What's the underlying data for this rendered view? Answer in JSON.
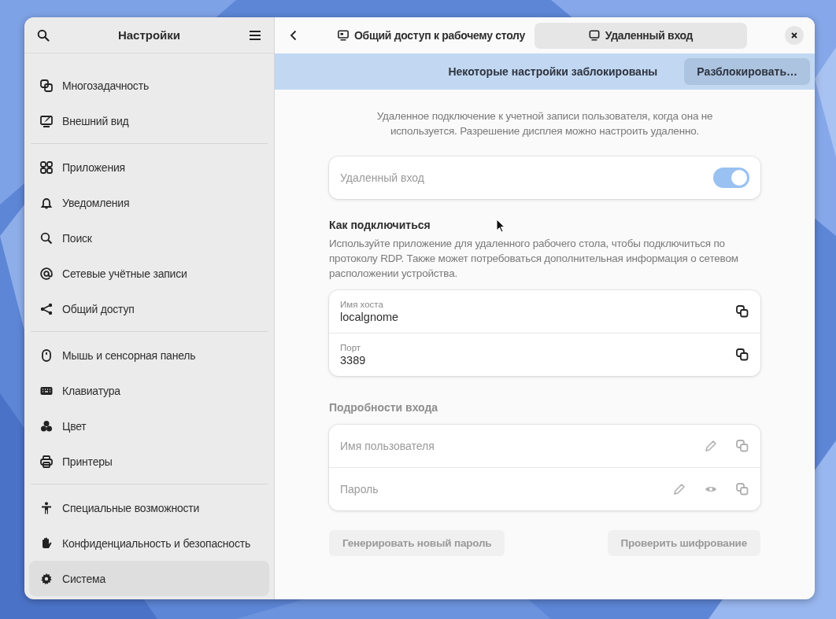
{
  "sidebar": {
    "title": "Настройки",
    "groups": [
      {
        "items": [
          {
            "label": "Многозадачность",
            "selected": false
          },
          {
            "label": "Внешний вид",
            "selected": false
          }
        ]
      },
      {
        "items": [
          {
            "label": "Приложения",
            "selected": false
          },
          {
            "label": "Уведомления",
            "selected": false
          },
          {
            "label": "Поиск",
            "selected": false
          },
          {
            "label": "Сетевые учётные записи",
            "selected": false
          },
          {
            "label": "Общий доступ",
            "selected": false
          }
        ]
      },
      {
        "items": [
          {
            "label": "Мышь и сенсорная панель",
            "selected": false
          },
          {
            "label": "Клавиатура",
            "selected": false
          },
          {
            "label": "Цвет",
            "selected": false
          },
          {
            "label": "Принтеры",
            "selected": false
          }
        ]
      },
      {
        "items": [
          {
            "label": "Специальные возможности",
            "selected": false
          },
          {
            "label": "Конфиденциальность и безопасность",
            "selected": false
          },
          {
            "label": "Система",
            "selected": true
          }
        ]
      }
    ]
  },
  "tabs": [
    {
      "label": "Общий доступ к рабочему столу",
      "selected": false
    },
    {
      "label": "Удаленный вход",
      "selected": true
    }
  ],
  "banner": {
    "message": "Некоторые настройки заблокированы",
    "button": "Разблокировать…"
  },
  "description": "Удаленное подключение к учетной записи пользователя, когда она не используется. Разрешение дисплея можно настроить удаленно.",
  "switch_row": {
    "label": "Удаленный вход",
    "on": true,
    "disabled": true
  },
  "how_to_connect": {
    "heading": "Как подключиться",
    "text": "Используйте приложение для удаленного рабочего стола, чтобы подключиться по протоколу RDP. Также может потребоваться дополнительная информация о сетевом расположении устройства.",
    "rows": [
      {
        "title": "Имя хоста",
        "value": "localgnome"
      },
      {
        "title": "Порт",
        "value": "3389"
      }
    ]
  },
  "login_details": {
    "heading": "Подробности входа",
    "disabled": true,
    "rows": [
      {
        "label": "Имя пользователя",
        "kind": "username"
      },
      {
        "label": "Пароль",
        "kind": "password"
      }
    ]
  },
  "buttons": [
    {
      "label": "Генерировать новый пароль",
      "disabled": true
    },
    {
      "label": "Проверить шифрование",
      "disabled": true
    }
  ]
}
